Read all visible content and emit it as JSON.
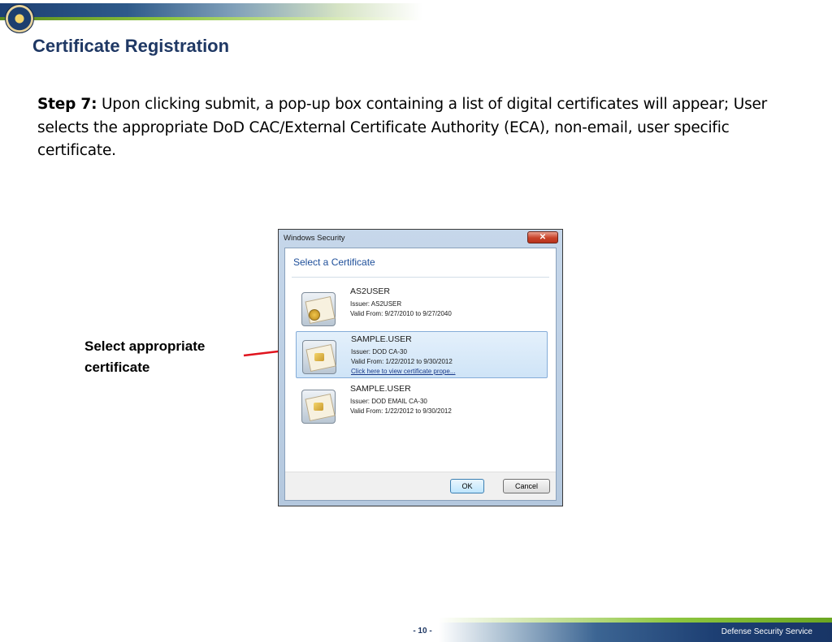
{
  "slide": {
    "title": "Certificate Registration",
    "step_label": "Step 7:",
    "step_text": " Upon clicking submit, a pop-up box containing a list of digital certificates will appear; User selects the appropriate DoD CAC/External Certificate Authority (ECA), non-email, user specific certificate.",
    "callout_line1": "Select appropriate",
    "callout_line2": "certificate",
    "page_number": "- 10 -",
    "organization": "Defense Security Service"
  },
  "dialog": {
    "window_title": "Windows Security",
    "close_glyph": "✕",
    "heading": "Select a Certificate",
    "certificates": [
      {
        "name": "AS2USER",
        "issuer": "Issuer: AS2USER",
        "valid": "Valid From: 9/27/2010 to 9/27/2040",
        "selected": false
      },
      {
        "name": "SAMPLE.USER",
        "issuer": "Issuer: DOD CA-30",
        "valid": "Valid From: 1/22/2012 to 9/30/2012",
        "link": "Click here to view certificate prope...",
        "selected": true
      },
      {
        "name": "SAMPLE.USER",
        "issuer": "Issuer: DOD EMAIL CA-30",
        "valid": "Valid From: 1/22/2012 to 9/30/2012",
        "selected": false
      }
    ],
    "ok_label": "OK",
    "cancel_label": "Cancel"
  },
  "colors": {
    "title": "#1f3864",
    "arrow": "#e0141e",
    "dialog_heading": "#1e4f9a"
  }
}
